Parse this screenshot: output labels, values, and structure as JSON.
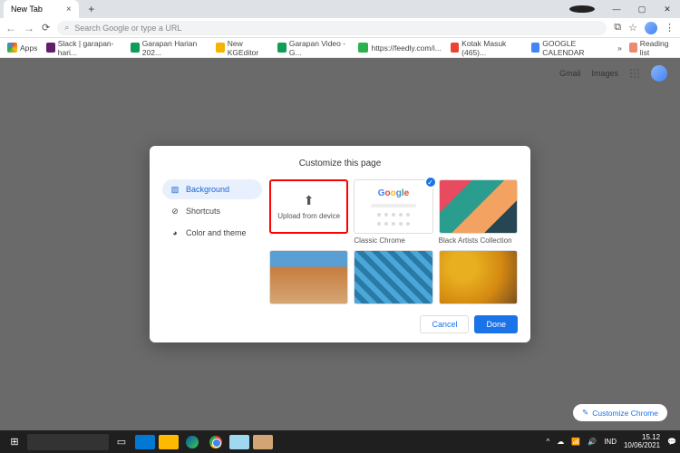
{
  "tab": {
    "title": "New Tab"
  },
  "omnibox": {
    "placeholder": "Search Google or type a URL"
  },
  "bookmarks": {
    "apps": "Apps",
    "items": [
      {
        "label": "Slack | garapan-hari...",
        "color": "#611f69"
      },
      {
        "label": "Garapan Harian 202...",
        "color": "#0f9d58"
      },
      {
        "label": "New KGEditor",
        "color": "#f4b400"
      },
      {
        "label": "Garapan Video - G...",
        "color": "#0f9d58"
      },
      {
        "label": "https://feedly.com/i...",
        "color": "#2bb24c"
      },
      {
        "label": "Kotak Masuk (465)...",
        "color": "#ea4335"
      },
      {
        "label": "GOOGLE CALENDAR",
        "color": "#4285f4"
      }
    ],
    "reading_list": "Reading list"
  },
  "top_links": {
    "gmail": "Gmail",
    "images": "Images"
  },
  "customize_btn": "Customize Chrome",
  "dialog": {
    "title": "Customize this page",
    "sidebar": [
      {
        "icon": "image",
        "label": "Background",
        "active": true
      },
      {
        "icon": "link",
        "label": "Shortcuts",
        "active": false
      },
      {
        "icon": "palette",
        "label": "Color and theme",
        "active": false
      }
    ],
    "upload_label": "Upload from device",
    "thumbs": [
      {
        "label": "Classic Chrome",
        "checked": true
      },
      {
        "label": "Black Artists Collection"
      }
    ],
    "cancel": "Cancel",
    "done": "Done"
  },
  "taskbar": {
    "lang": "IND",
    "time": "15.12",
    "date": "10/06/2021"
  }
}
